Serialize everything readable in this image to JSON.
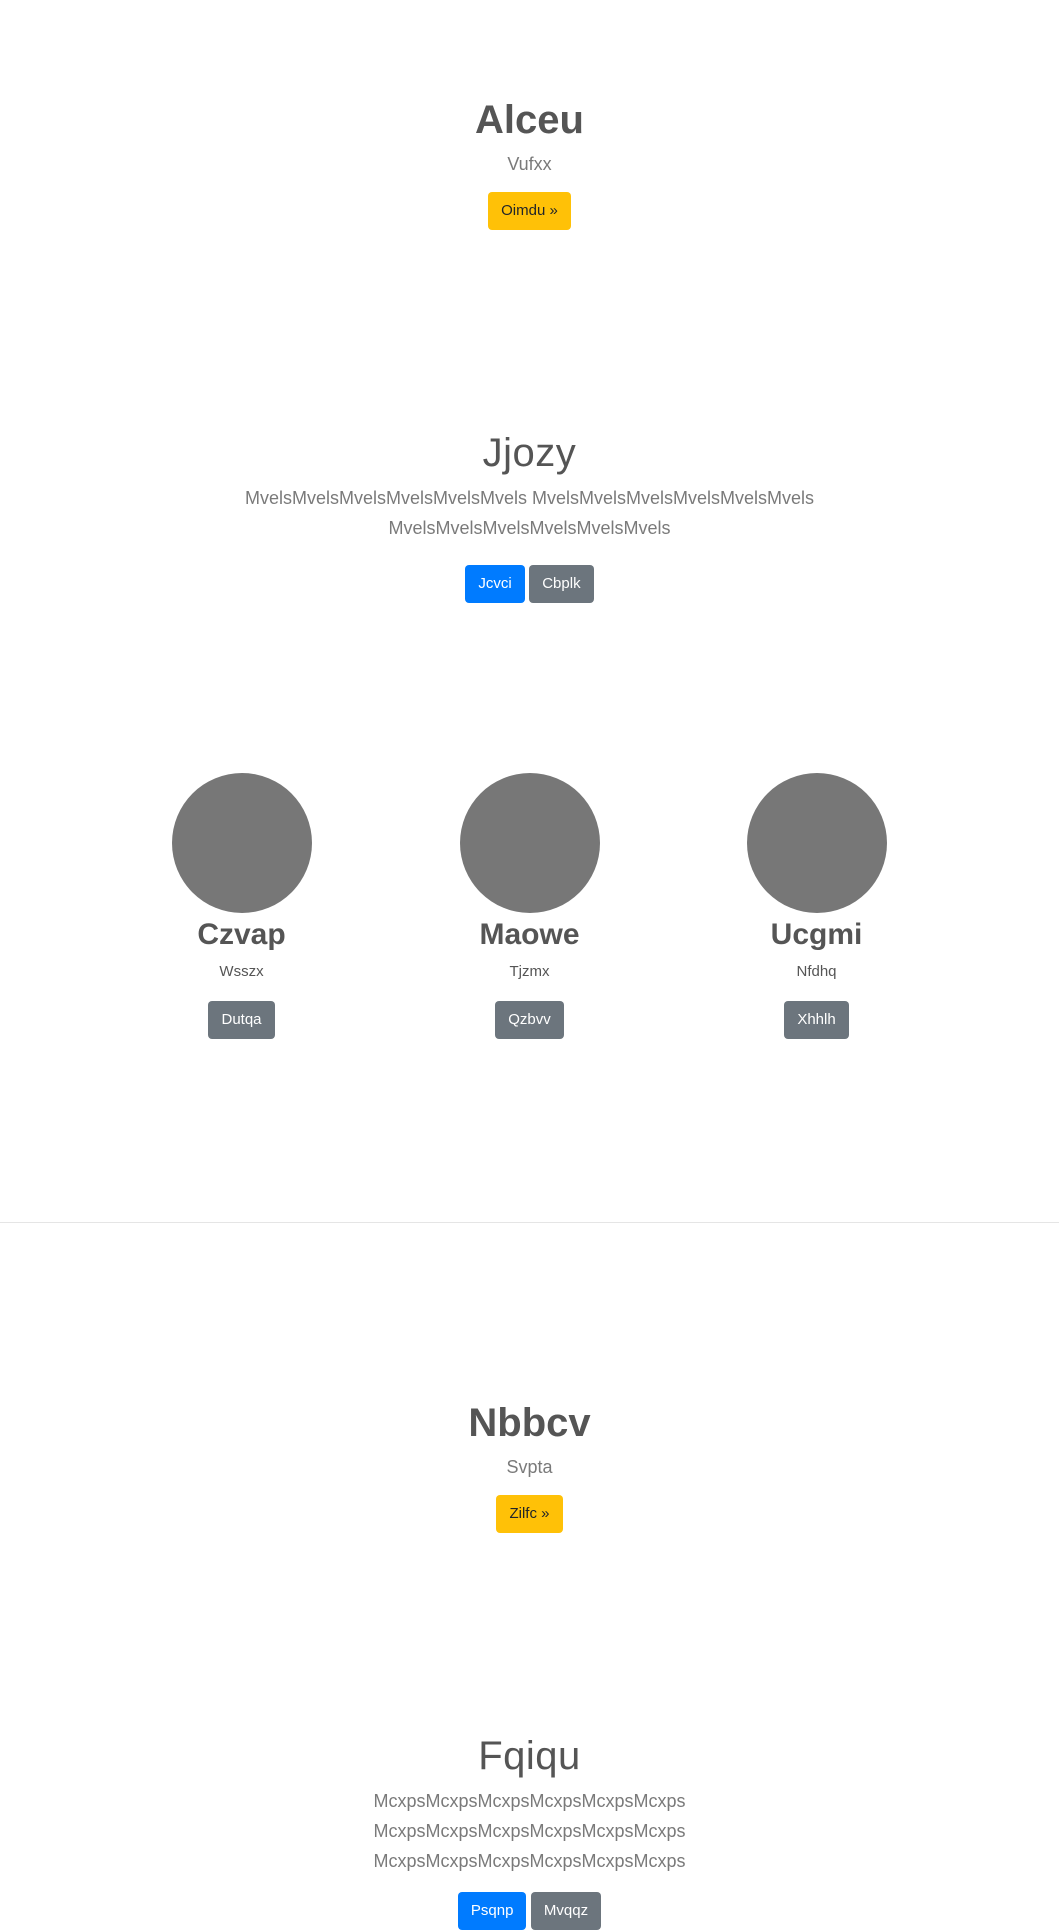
{
  "hero1": {
    "title": "Alceu",
    "subtitle": "Vufxx",
    "button_label": "Oimdu »"
  },
  "section1": {
    "title": "Jjozy",
    "text_line1": "MvelsMvelsMvelsMvelsMvelsMvels MvelsMvelsMvelsMvelsMvelsMvels",
    "text_line2": "MvelsMvelsMvelsMvelsMvelsMvels",
    "primary_label": "Jcvci",
    "secondary_label": "Cbplk"
  },
  "features": [
    {
      "name": "Czvap",
      "desc": "Wsszx",
      "button_label": "Dutqa"
    },
    {
      "name": "Maowe",
      "desc": "Tjzmx",
      "button_label": "Qzbvv"
    },
    {
      "name": "Ucgmi",
      "desc": "Nfdhq",
      "button_label": "Xhhlh"
    }
  ],
  "hero2": {
    "title": "Nbbcv",
    "subtitle": "Svpta",
    "button_label": "Zilfc »"
  },
  "section2": {
    "title": "Fqiqu",
    "text_line1": "McxpsMcxpsMcxpsMcxpsMcxpsMcxps",
    "text_line2": "McxpsMcxpsMcxpsMcxpsMcxpsMcxps",
    "text_line3": "McxpsMcxpsMcxpsMcxpsMcxpsMcxps",
    "primary_label": "Psqnp",
    "secondary_label": "Mvqqz"
  }
}
